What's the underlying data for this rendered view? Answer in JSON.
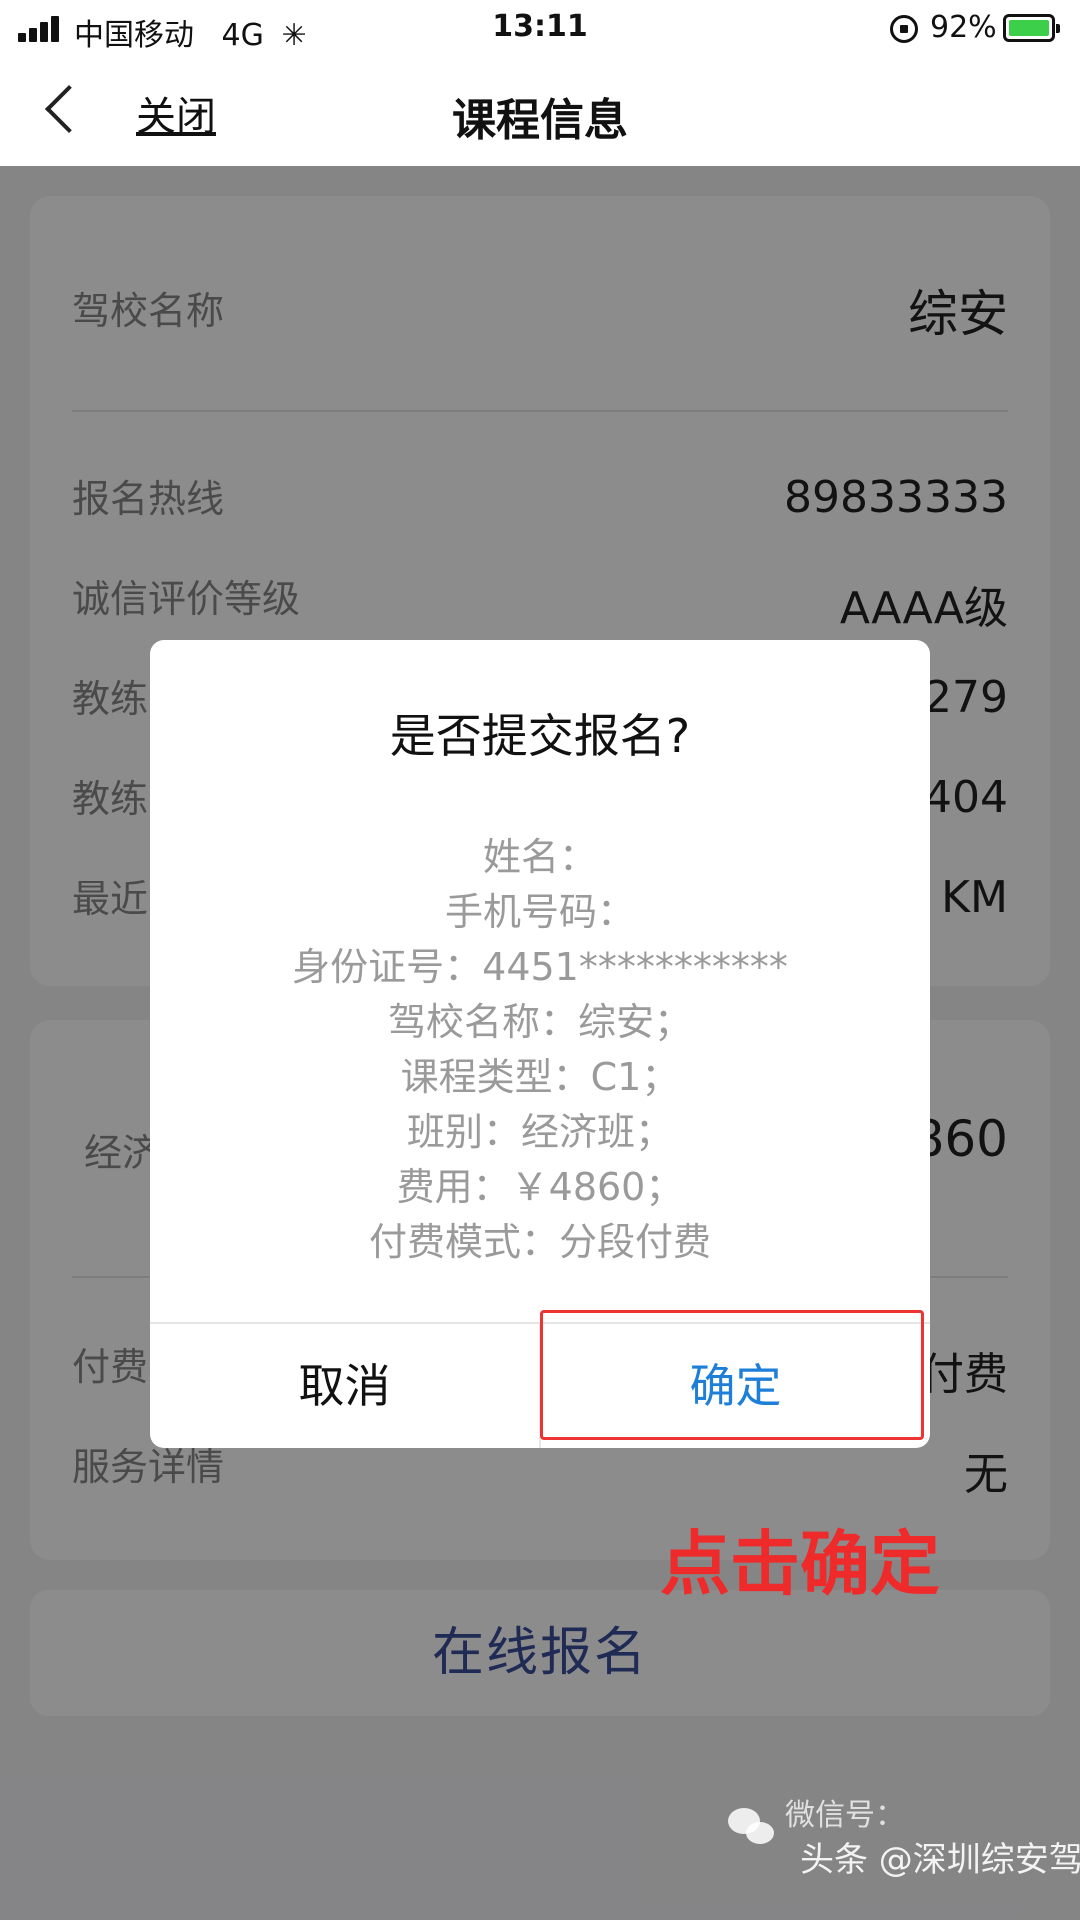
{
  "status_bar": {
    "carrier": "中国移动",
    "network": "4G",
    "time": "13:11",
    "battery": "92%"
  },
  "nav": {
    "close_label": "关闭",
    "title": "课程信息"
  },
  "course_info": {
    "school_label": "驾校名称",
    "school_value": "综安",
    "rows": [
      {
        "label": "报名热线",
        "value": "89833333"
      },
      {
        "label": "诚信评价等级",
        "value": "AAAA级"
      },
      {
        "label": "教练",
        "value": "279"
      },
      {
        "label": "教练",
        "value": "404"
      },
      {
        "label": "最近",
        "value": "KM"
      }
    ]
  },
  "class_info": {
    "class_label": "经济",
    "price_value": "860",
    "payment_label": "付费",
    "payment_value": "付费",
    "service_label": "服务详情",
    "service_value": "无"
  },
  "online_signup_button": "在线报名",
  "dialog": {
    "title": "是否提交报名?",
    "lines": [
      "姓名：",
      "手机号码：",
      "身份证号：4451***********",
      "驾校名称：综安；",
      "课程类型：C1；",
      "班别：经济班；",
      "费用：￥4860；",
      "付费模式：分段付费"
    ],
    "cancel": "取消",
    "confirm": "确定"
  },
  "annotation": {
    "label": "点击确定",
    "color": "#ee2a2a"
  },
  "watermark": {
    "wechat_id": "微信号：",
    "account": "头条 @深圳综安驾校"
  },
  "colors": {
    "confirm_blue": "#1e7fd8",
    "signup_text": "#3a4e9c"
  }
}
